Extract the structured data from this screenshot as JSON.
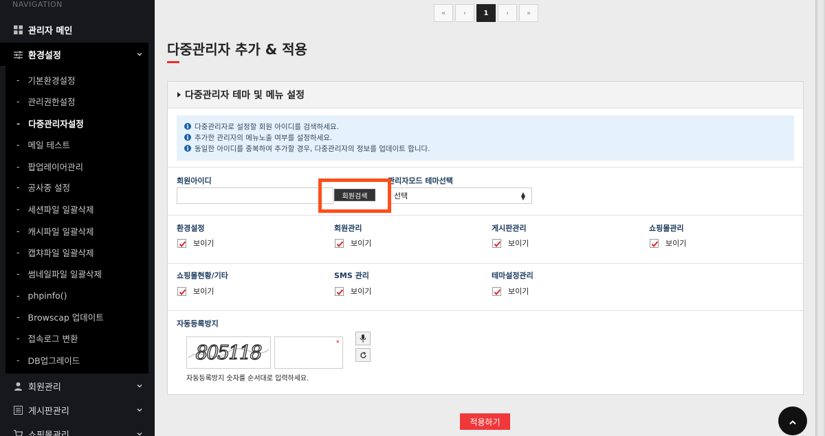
{
  "sidebar": {
    "heading": "NAVIGATION",
    "top_items": [
      {
        "label": "관리자 메인",
        "icon": "grid-icon"
      },
      {
        "label": "환경설정",
        "icon": "sliders-icon"
      }
    ],
    "sub_items": [
      {
        "label": "기본환경설정"
      },
      {
        "label": "관리권한설정"
      },
      {
        "label": "다중관리자설정"
      },
      {
        "label": "메일 테스트"
      },
      {
        "label": "팝업레이어관리"
      },
      {
        "label": "공사중 설정"
      },
      {
        "label": "세션파일 일괄삭제"
      },
      {
        "label": "캐시파일 일괄삭제"
      },
      {
        "label": "캡챠파일 일괄삭제"
      },
      {
        "label": "썸네일파일 일괄삭제"
      },
      {
        "label": "phpinfo()"
      },
      {
        "label": "Browscap 업데이트"
      },
      {
        "label": "접속로그 변환"
      },
      {
        "label": "DB업그레이드"
      }
    ],
    "bottom_items": [
      {
        "label": "회원관리",
        "icon": "user-icon"
      },
      {
        "label": "게시판관리",
        "icon": "list-icon"
      },
      {
        "label": "쇼핑몰관리",
        "icon": "cart-icon"
      }
    ]
  },
  "pagination": {
    "first": "«",
    "prev": "‹",
    "current": "1",
    "next": "›",
    "last": "»"
  },
  "page_title": "다중관리자 추가 & 적용",
  "panel": {
    "title": "다중관리자 테마 및 메뉴 설정",
    "info": [
      "다중관리자로 설정할 회원 아이디를 검색하세요.",
      "추가한 관리자의 메뉴노출 여부를 설정하세요.",
      "동일한 아이디를 중복하여 추가할 경우, 다중관리자의 정보를 업데이트 합니다."
    ],
    "member_id_label": "회원아이디",
    "member_id_value": "",
    "search_button": "회원검색",
    "theme_label": "관리자모드 테마선택",
    "theme_value": "선택",
    "checks_row1": [
      {
        "label": "환경설정",
        "option": "보이기"
      },
      {
        "label": "회원관리",
        "option": "보이기"
      },
      {
        "label": "게시판관리",
        "option": "보이기"
      },
      {
        "label": "쇼핑몰관리",
        "option": "보이기"
      }
    ],
    "checks_row2": [
      {
        "label": "쇼핑몰현황/기타",
        "option": "보이기"
      },
      {
        "label": "SMS 관리",
        "option": "보이기"
      },
      {
        "label": "테마설정관리",
        "option": "보이기"
      }
    ],
    "captcha_label": "자동등록방지",
    "captcha_image_text": "805118",
    "captcha_required_mark": "*",
    "captcha_help": "자동등록방지 숫자를 순서대로 입력하세요."
  },
  "apply_button": "적용하기",
  "colors": {
    "accent": "#f0383b",
    "highlight": "#ff4e1a",
    "sidebar": "#16181c"
  }
}
